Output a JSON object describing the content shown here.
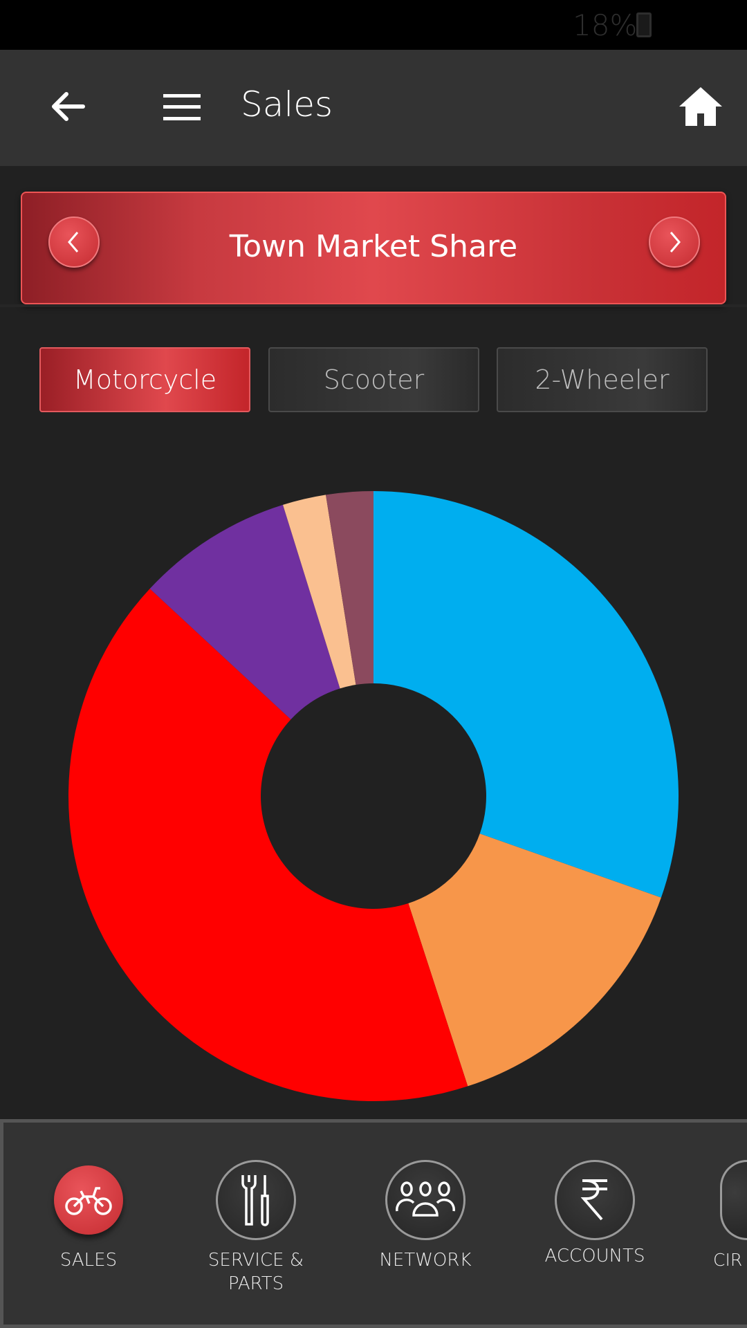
{
  "status_bar": {
    "battery": "18%"
  },
  "app_bar": {
    "title": "Sales",
    "icons": [
      "back-arrow-icon",
      "hamburger-menu-icon",
      "home-icon"
    ]
  },
  "banner": {
    "title": "Town Market Share",
    "prev_icon": "chevron-left-icon",
    "next_icon": "chevron-right-icon"
  },
  "tabs": [
    {
      "label": "Motorcycle",
      "active": true
    },
    {
      "label": "Scooter",
      "active": false
    },
    {
      "label": "2-Wheeler",
      "active": false
    }
  ],
  "chart_data": {
    "type": "pie",
    "donut": true,
    "start": "top, clockwise",
    "legend": "none",
    "slices": [
      {
        "value": 30.4,
        "color": "#00aeef"
      },
      {
        "value": 14.6,
        "color": "#f7964a"
      },
      {
        "value": 41.9,
        "color": "#ff0000"
      },
      {
        "value": 8.3,
        "color": "#7030a0"
      },
      {
        "value": 2.3,
        "color": "#fac090"
      },
      {
        "value": 2.5,
        "color": "#8b4a5e"
      }
    ]
  },
  "bottom_nav": [
    {
      "label": "SALES",
      "icon": "motorcycle-icon",
      "active": true
    },
    {
      "label": "SERVICE & PARTS",
      "icon": "wrench-screwdriver-icon",
      "active": false
    },
    {
      "label": "NETWORK",
      "icon": "people-group-icon",
      "active": false
    },
    {
      "label": "ACCOUNTS",
      "icon": "rupee-icon",
      "active": false
    },
    {
      "label": "CIR",
      "icon": "document-icon",
      "active": false
    }
  ],
  "colors": {
    "accent": "#e0484d",
    "background": "#212121",
    "appbar": "#333333"
  }
}
